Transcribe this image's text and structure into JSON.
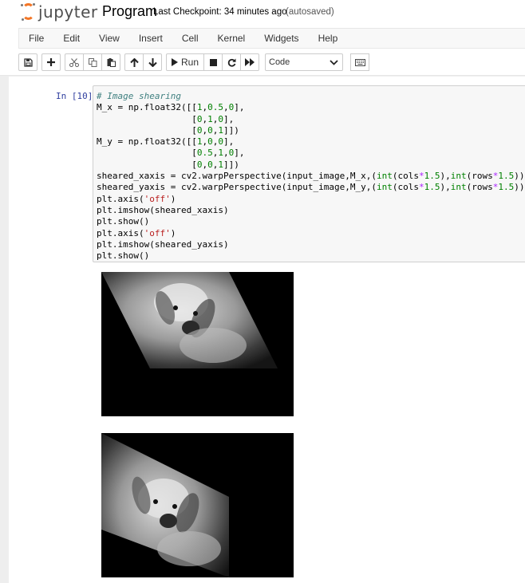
{
  "header": {
    "logo_text": "jupyter",
    "notebook_name": "Program",
    "checkpoint_label": "Last Checkpoint: 34 minutes ago",
    "autosave_status": "(autosaved)"
  },
  "menubar": {
    "items": [
      "File",
      "Edit",
      "View",
      "Insert",
      "Cell",
      "Kernel",
      "Widgets",
      "Help"
    ]
  },
  "toolbar": {
    "run_label": "Run",
    "cell_type": "Code",
    "icons": [
      "save-icon",
      "plus-icon",
      "cut-icon",
      "copy-icon",
      "paste-icon",
      "arrow-up-icon",
      "arrow-down-icon",
      "run-icon",
      "stop-icon",
      "restart-icon",
      "fast-forward-icon",
      "keyboard-icon"
    ]
  },
  "cell": {
    "prompt": "In [10]:",
    "code_lines": [
      [
        {
          "t": "# Image shearing",
          "c": "cm"
        }
      ],
      [
        {
          "t": "M_x = np.float32([[",
          "c": ""
        },
        {
          "t": "1",
          "c": "num"
        },
        {
          "t": ",",
          "c": ""
        },
        {
          "t": "0.5",
          "c": "num"
        },
        {
          "t": ",",
          "c": ""
        },
        {
          "t": "0",
          "c": "num"
        },
        {
          "t": "],",
          "c": ""
        }
      ],
      [
        {
          "t": "                  [",
          "c": ""
        },
        {
          "t": "0",
          "c": "num"
        },
        {
          "t": ",",
          "c": ""
        },
        {
          "t": "1",
          "c": "num"
        },
        {
          "t": ",",
          "c": ""
        },
        {
          "t": "0",
          "c": "num"
        },
        {
          "t": "],",
          "c": ""
        }
      ],
      [
        {
          "t": "                  [",
          "c": ""
        },
        {
          "t": "0",
          "c": "num"
        },
        {
          "t": ",",
          "c": ""
        },
        {
          "t": "0",
          "c": "num"
        },
        {
          "t": ",",
          "c": ""
        },
        {
          "t": "1",
          "c": "num"
        },
        {
          "t": "]])",
          "c": ""
        }
      ],
      [
        {
          "t": "M_y = np.float32([[",
          "c": ""
        },
        {
          "t": "1",
          "c": "num"
        },
        {
          "t": ",",
          "c": ""
        },
        {
          "t": "0",
          "c": "num"
        },
        {
          "t": ",",
          "c": ""
        },
        {
          "t": "0",
          "c": "num"
        },
        {
          "t": "],",
          "c": ""
        }
      ],
      [
        {
          "t": "                  [",
          "c": ""
        },
        {
          "t": "0.5",
          "c": "num"
        },
        {
          "t": ",",
          "c": ""
        },
        {
          "t": "1",
          "c": "num"
        },
        {
          "t": ",",
          "c": ""
        },
        {
          "t": "0",
          "c": "num"
        },
        {
          "t": "],",
          "c": ""
        }
      ],
      [
        {
          "t": "                  [",
          "c": ""
        },
        {
          "t": "0",
          "c": "num"
        },
        {
          "t": ",",
          "c": ""
        },
        {
          "t": "0",
          "c": "num"
        },
        {
          "t": ",",
          "c": ""
        },
        {
          "t": "1",
          "c": "num"
        },
        {
          "t": "]])",
          "c": ""
        }
      ],
      [
        {
          "t": "sheared_xaxis = cv2.warpPerspective(input_image,M_x,(",
          "c": ""
        },
        {
          "t": "int",
          "c": "kw"
        },
        {
          "t": "(cols",
          "c": ""
        },
        {
          "t": "*",
          "c": "op"
        },
        {
          "t": "1.5",
          "c": "num"
        },
        {
          "t": "),",
          "c": ""
        },
        {
          "t": "int",
          "c": "kw"
        },
        {
          "t": "(rows",
          "c": ""
        },
        {
          "t": "*",
          "c": "op"
        },
        {
          "t": "1.5",
          "c": "num"
        },
        {
          "t": ")))",
          "c": ""
        }
      ],
      [
        {
          "t": "sheared_yaxis = cv2.warpPerspective(input_image,M_y,(",
          "c": ""
        },
        {
          "t": "int",
          "c": "kw"
        },
        {
          "t": "(cols",
          "c": ""
        },
        {
          "t": "*",
          "c": "op"
        },
        {
          "t": "1.5",
          "c": "num"
        },
        {
          "t": "),",
          "c": ""
        },
        {
          "t": "int",
          "c": "kw"
        },
        {
          "t": "(rows",
          "c": ""
        },
        {
          "t": "*",
          "c": "op"
        },
        {
          "t": "1.5",
          "c": "num"
        },
        {
          "t": ")))",
          "c": ""
        }
      ],
      [
        {
          "t": "plt.axis(",
          "c": ""
        },
        {
          "t": "'off'",
          "c": "str"
        },
        {
          "t": ")",
          "c": ""
        }
      ],
      [
        {
          "t": "plt.imshow(sheared_xaxis)",
          "c": ""
        }
      ],
      [
        {
          "t": "plt.show()",
          "c": ""
        }
      ],
      [
        {
          "t": "plt.axis(",
          "c": ""
        },
        {
          "t": "'off'",
          "c": "str"
        },
        {
          "t": ")",
          "c": ""
        }
      ],
      [
        {
          "t": "plt.imshow(sheared_yaxis)",
          "c": ""
        }
      ],
      [
        {
          "t": "plt.show()",
          "c": ""
        }
      ]
    ]
  },
  "outputs": [
    {
      "image_content": "sheared-xaxis-dog-image"
    },
    {
      "image_content": "sheared-yaxis-dog-image"
    }
  ],
  "colors": {
    "accent_orange": "#f37626",
    "prompt_blue": "#303f9f",
    "comment": "#408080",
    "number": "#008000",
    "string": "#ba2121",
    "operator": "#aa22ff"
  }
}
